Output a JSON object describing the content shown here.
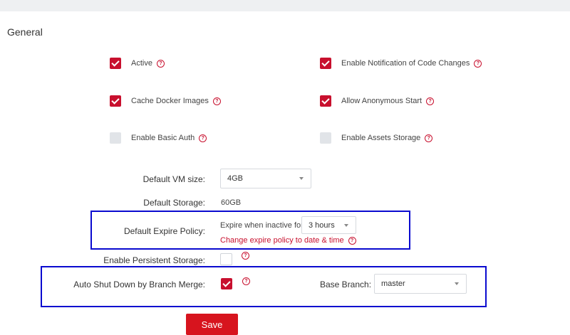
{
  "section_title": "General",
  "options": [
    {
      "label": "Active",
      "checked": true
    },
    {
      "label": "Enable Notification of Code Changes",
      "checked": true
    },
    {
      "label": "Cache Docker Images",
      "checked": true
    },
    {
      "label": "Allow Anonymous Start",
      "checked": true
    },
    {
      "label": "Enable Basic Auth",
      "checked": false
    },
    {
      "label": "Enable Assets Storage",
      "checked": false
    }
  ],
  "vm_size": {
    "label": "Default VM size:",
    "value": "4GB"
  },
  "storage": {
    "label": "Default Storage:",
    "value": "60GB"
  },
  "expire": {
    "label": "Default Expire Policy:",
    "prefix": "Expire when inactive for",
    "value": "3 hours",
    "change_link": "Change expire policy to date & time"
  },
  "persistent_storage": {
    "label": "Enable Persistent Storage:",
    "checked": false
  },
  "auto_shutdown": {
    "label": "Auto Shut Down by Branch Merge:",
    "checked": true
  },
  "base_branch": {
    "label": "Base Branch:",
    "value": "master"
  },
  "help_glyph": "?",
  "save_label": "Save",
  "colors": {
    "accent": "#c8102e",
    "highlight": "#0a0acf",
    "save": "#d7141e"
  }
}
